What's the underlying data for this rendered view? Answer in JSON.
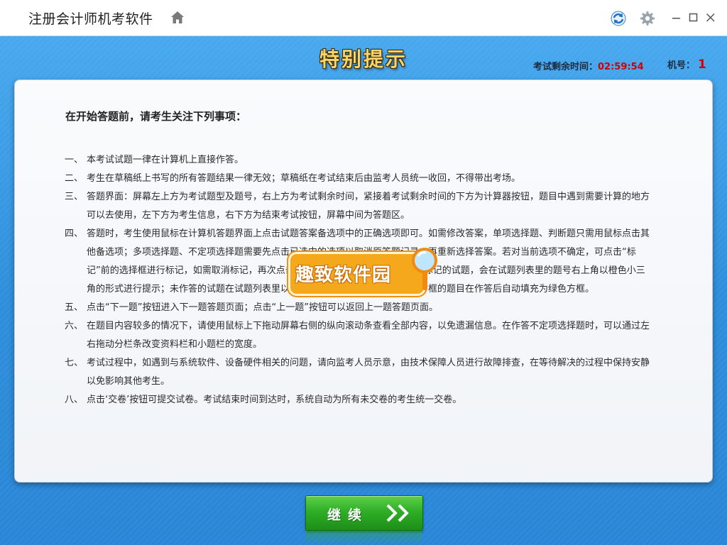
{
  "window": {
    "title": "注册会计师机考软件",
    "icons": [
      "home-icon",
      "refresh-icon",
      "gear-icon",
      "minimize-icon",
      "maximize-icon",
      "close-icon"
    ]
  },
  "header": {
    "title": "特别提示",
    "timer_label": "考试剩余时间：",
    "timer_value": "02:59:54",
    "machine_label": "机号：",
    "machine_value": "1"
  },
  "panel": {
    "heading": "在开始答题前，请考生关注下列事项：",
    "rules": [
      {
        "num": "一、",
        "text": "本考试试题一律在计算机上直接作答。"
      },
      {
        "num": "二、",
        "text": "考生在草稿纸上书写的所有答题结果一律无效；草稿纸在考试结束后由监考人员统一收回，不得带出考场。"
      },
      {
        "num": "三、",
        "text": "答题界面：屏幕左上方为考试题型及题号，右上方为考试剩余时间，紧接着考试剩余时间的下方为计算器按钮，题目中遇到需要计算的地方可以去使用，左下方为考生信息，右下方为结束考试按钮，屏幕中间为答题区。"
      },
      {
        "num": "四、",
        "text": "答题时，考生使用鼠标在计算机答题界面上点击试题答案备选项中的正确选项即可。如需修改答案，单项选择题、判断题只需用鼠标点击其他备选项；多项选择题、不定项选择题需要先点击已选中的选项以取消原答题记录，再重新选择答案。若对当前选项不确定，可点击“标记”前的选择框进行标记，如需取消标记，再次点击该选择框可以取消本题标记。被标记的试题，会在试题列表里的题号右上角以橙色小三角的形式进行提示；未作答的试题在试题列表里以白色方框进行显示，显示为白色方框的题目在作答后自动填充为绿色方框。"
      },
      {
        "num": "五、",
        "text": "点击“下一题”按钮进入下一题答题页面；点击“上一题”按钮可以返回上一题答题页面。"
      },
      {
        "num": "六、",
        "text": "在题目内容较多的情况下，请使用鼠标上下拖动屏幕右侧的纵向滚动条查看全部内容，以免遗漏信息。在作答不定项选择题时，可以通过左右拖动分栏条改变资料栏和小题栏的宽度。"
      },
      {
        "num": "七、",
        "text": "考试过程中，如遇到与系统软件、设备硬件相关的问题，请向监考人员示意，由技术保障人员进行故障排查，在等待解决的过程中保持安静以免影响其他考生。"
      },
      {
        "num": "八、",
        "text": "点击‘交卷’按钮可提交试卷。考试结束时间到达时，系统自动为所有未交卷的考生统一交卷。"
      }
    ]
  },
  "watermark": {
    "text": "趣致软件园"
  },
  "footer": {
    "continue_label": "继续",
    "continue_icon": "double-chevron-right-icon"
  },
  "colors": {
    "background_blue": "#3a9be6",
    "title_gold": "#f6d46a",
    "timer_red": "#d40000",
    "button_green": "#2fae27",
    "watermark_orange": "#f5a81c"
  }
}
